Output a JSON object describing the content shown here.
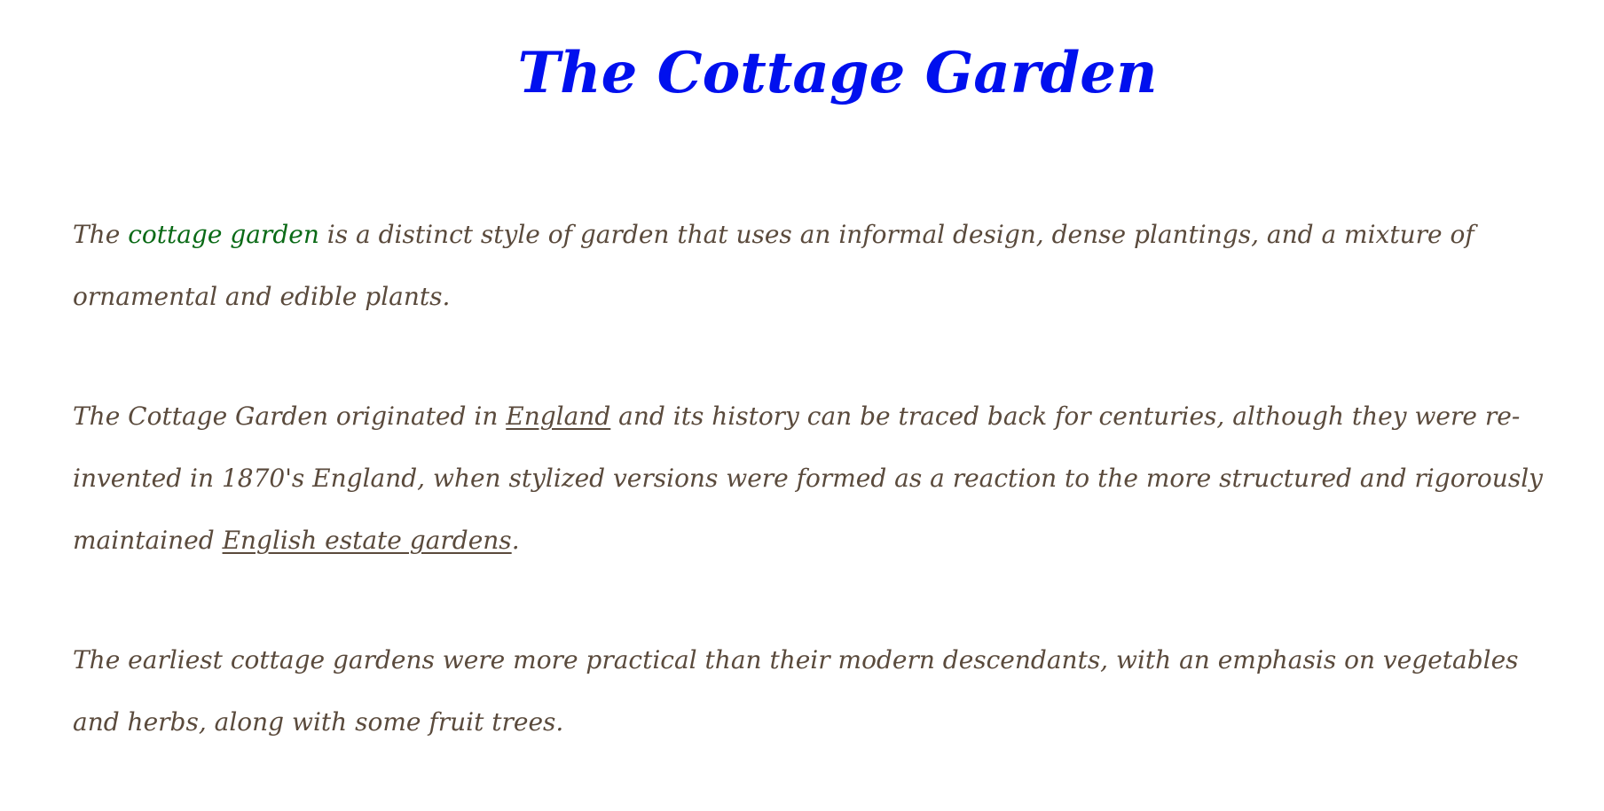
{
  "title": "The Cottage Garden",
  "paragraphs": [
    {
      "p1_pre": "The ",
      "p1_highlight": "cottage garden",
      "p1_post": " is a distinct style of garden that uses an informal design, dense plantings, and a mixture of ornamental and edible plants."
    },
    {
      "p2_pre": "The Cottage Garden originated in ",
      "p2_link1": "England",
      "p2_mid": " and its history can be traced back for centuries, although they were re-invented in 1870's England, when stylized versions were formed as a reaction to the more structured and rigorously maintained ",
      "p2_link2": "English estate gardens",
      "p2_post": "."
    },
    {
      "p3_text": "The earliest cottage gardens were more practical than their modern descendants, with an emphasis on vegetables and herbs, along with some fruit trees."
    }
  ],
  "colors": {
    "title": "#0010ee",
    "body_text": "#5a4a3c",
    "highlight": "#0a6a16",
    "background": "#ffffff"
  }
}
